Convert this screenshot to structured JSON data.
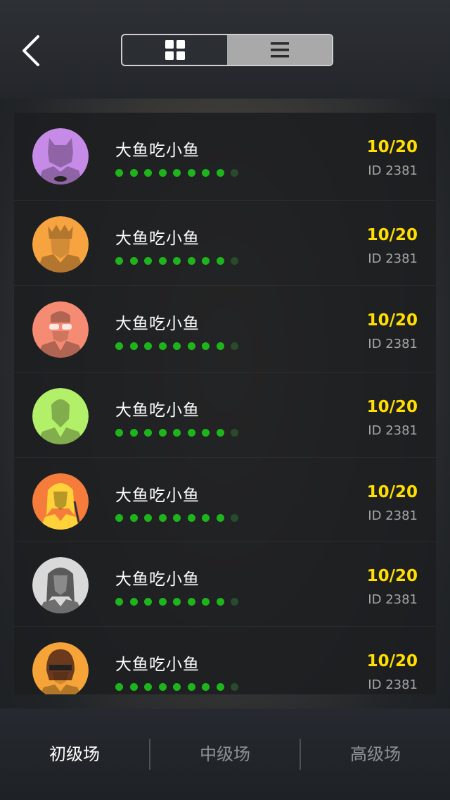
{
  "header": {
    "back_icon": "chevron-left-icon",
    "view_toggle": [
      {
        "name": "grid",
        "icon": "grid-icon",
        "selected": true
      },
      {
        "name": "list",
        "icon": "list-icon",
        "selected": false
      }
    ]
  },
  "rows": [
    {
      "name": "大鱼吃小鱼",
      "score": "10/20",
      "id": "ID 2381",
      "avatar": "purple-masked-hero",
      "color": "#c58be7"
    },
    {
      "name": "大鱼吃小鱼",
      "score": "10/20",
      "id": "ID 2381",
      "avatar": "orange-crowned-warrior",
      "color": "#f7a440"
    },
    {
      "name": "大鱼吃小鱼",
      "score": "10/20",
      "id": "ID 2381",
      "avatar": "red-sunglasses-man",
      "color": "#f48b72"
    },
    {
      "name": "大鱼吃小鱼",
      "score": "10/20",
      "id": "ID 2381",
      "avatar": "green-man",
      "color": "#b3f06a"
    },
    {
      "name": "大鱼吃小鱼",
      "score": "10/20",
      "id": "ID 2381",
      "avatar": "blonde-swordswoman",
      "color": "#f57c3a"
    },
    {
      "name": "大鱼吃小鱼",
      "score": "10/20",
      "id": "ID 2381",
      "avatar": "grey-woman",
      "color": "#d9d9d9"
    },
    {
      "name": "大鱼吃小鱼",
      "score": "10/20",
      "id": "ID 2381",
      "avatar": "masked-bandit",
      "color": "#f6a437"
    }
  ],
  "progress": {
    "filled": 8,
    "total": 9
  },
  "tabs": [
    {
      "label": "初级场",
      "active": true
    },
    {
      "label": "中级场",
      "active": false
    },
    {
      "label": "高级场",
      "active": false
    }
  ],
  "colors": {
    "score": "#ffde00",
    "dot_on": "#1eb51c",
    "dot_off": "#2a4a2c",
    "tab_active": "#ffffff",
    "tab_inactive": "#8d9096"
  }
}
